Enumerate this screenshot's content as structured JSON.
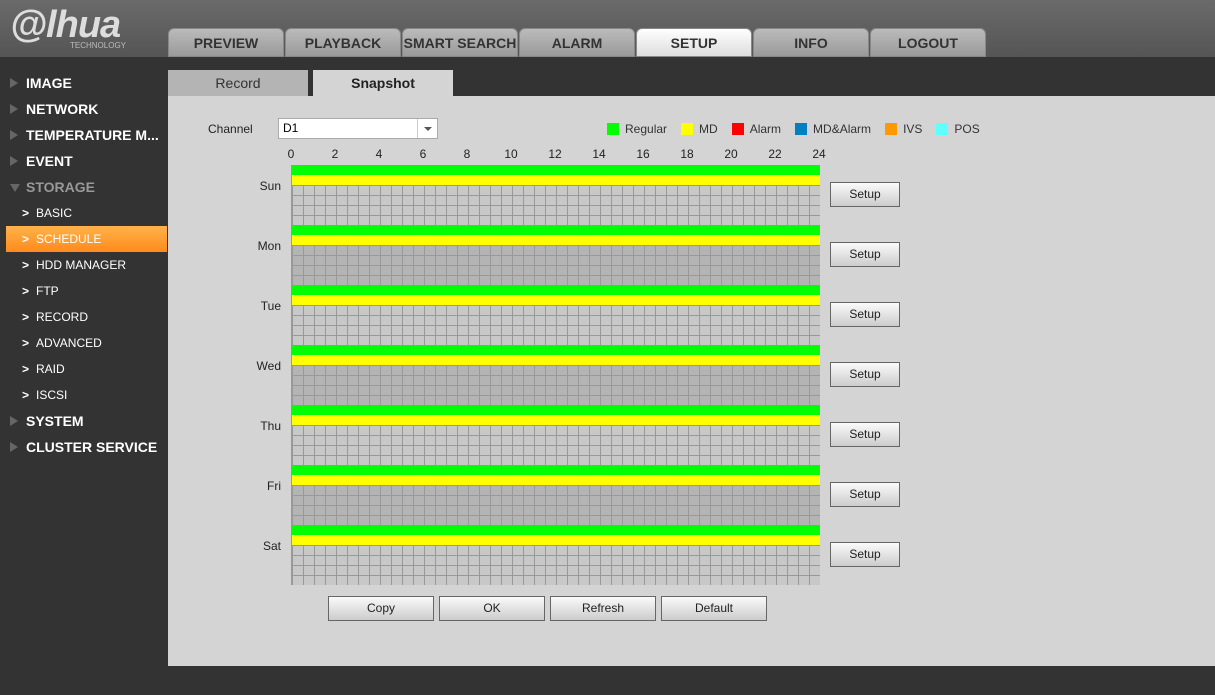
{
  "logo": {
    "brand": "alhua",
    "sub": "TECHNOLOGY"
  },
  "nav": [
    {
      "label": "PREVIEW"
    },
    {
      "label": "PLAYBACK"
    },
    {
      "label": "SMART SEARCH"
    },
    {
      "label": "ALARM"
    },
    {
      "label": "SETUP",
      "active": true
    },
    {
      "label": "INFO"
    },
    {
      "label": "LOGOUT"
    }
  ],
  "sidebar": {
    "top": [
      "IMAGE",
      "NETWORK",
      "TEMPERATURE M...",
      "EVENT"
    ],
    "storage": "STORAGE",
    "storage_items": [
      "BASIC",
      "SCHEDULE",
      "HDD MANAGER",
      "FTP",
      "RECORD",
      "ADVANCED",
      "RAID",
      "ISCSI"
    ],
    "selected": "SCHEDULE",
    "bottom": [
      "SYSTEM",
      "CLUSTER SERVICE"
    ]
  },
  "tabs": {
    "record": "Record",
    "snapshot": "Snapshot",
    "active": "Snapshot"
  },
  "channel": {
    "label": "Channel",
    "value": "D1"
  },
  "legend": [
    {
      "label": "Regular",
      "color": "#00ff00"
    },
    {
      "label": "MD",
      "color": "#ffff00"
    },
    {
      "label": "Alarm",
      "color": "#ff0000"
    },
    {
      "label": "MD&Alarm",
      "color": "#0080c0"
    },
    {
      "label": "IVS",
      "color": "#ff9900"
    },
    {
      "label": "POS",
      "color": "#60ffff"
    }
  ],
  "hours": [
    "0",
    "2",
    "4",
    "6",
    "8",
    "10",
    "12",
    "14",
    "16",
    "18",
    "20",
    "22",
    "24"
  ],
  "days": [
    {
      "label": "Sun",
      "regular": [
        0,
        24
      ],
      "md": [
        0,
        24
      ]
    },
    {
      "label": "Mon",
      "regular": [
        0,
        24
      ],
      "md": [
        0,
        24
      ]
    },
    {
      "label": "Tue",
      "regular": [
        0,
        24
      ],
      "md": [
        0,
        24
      ]
    },
    {
      "label": "Wed",
      "regular": [
        0,
        24
      ],
      "md": [
        0,
        24
      ]
    },
    {
      "label": "Thu",
      "regular": [
        0,
        24
      ],
      "md": [
        0,
        24
      ]
    },
    {
      "label": "Fri",
      "regular": [
        0,
        24
      ],
      "md": [
        0,
        24
      ]
    },
    {
      "label": "Sat",
      "regular": [
        0,
        24
      ],
      "md": [
        0,
        24
      ]
    }
  ],
  "setup_label": "Setup",
  "buttons": {
    "copy": "Copy",
    "ok": "OK",
    "refresh": "Refresh",
    "default": "Default"
  }
}
